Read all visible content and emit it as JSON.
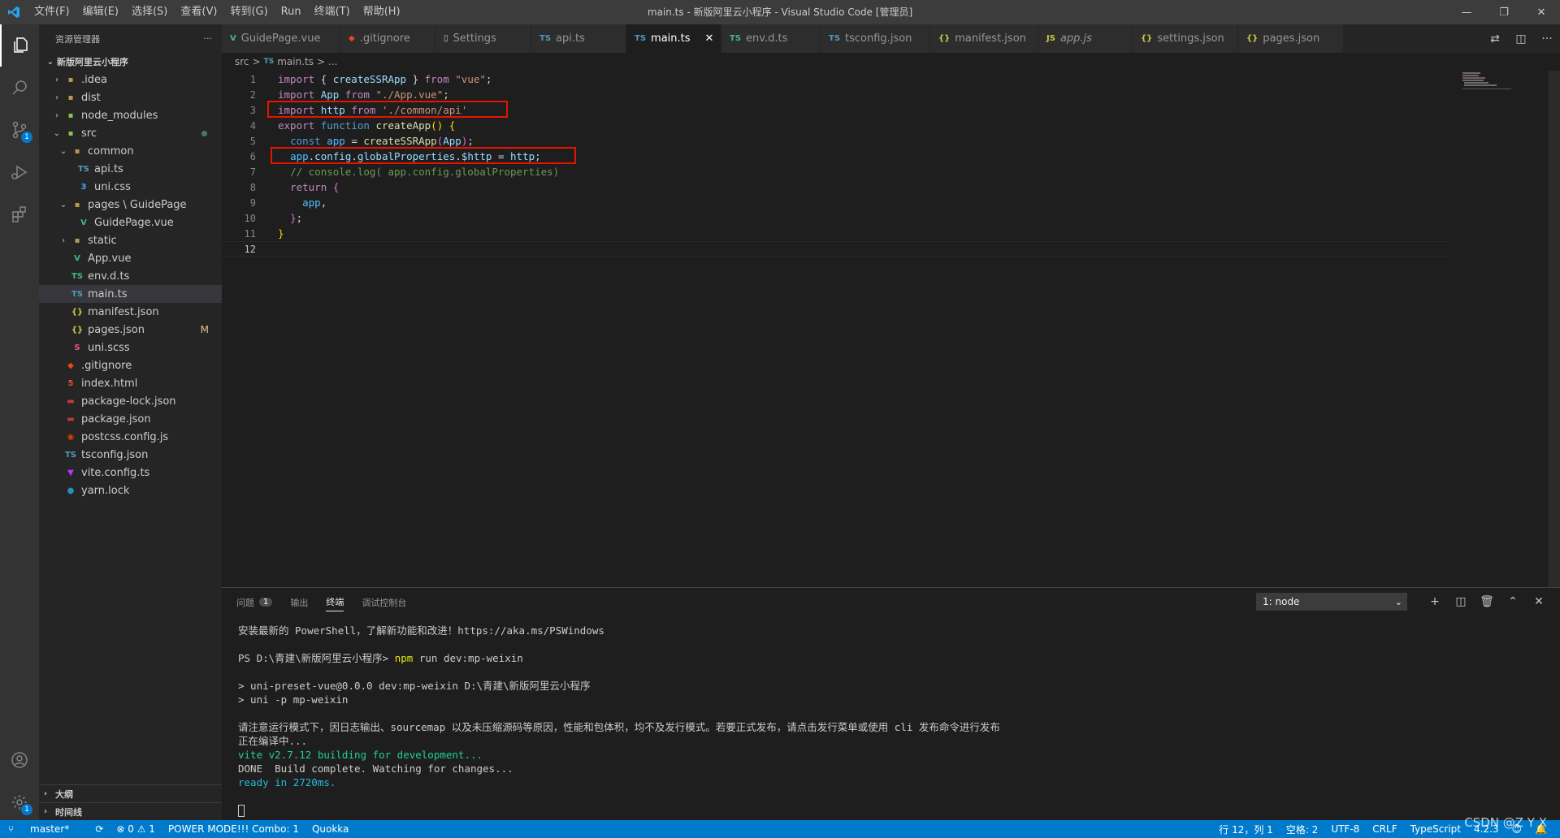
{
  "titlebar": {
    "menus": [
      "文件(F)",
      "编辑(E)",
      "选择(S)",
      "查看(V)",
      "转到(G)",
      "Run",
      "终端(T)",
      "帮助(H)"
    ],
    "title": "main.ts - 新版阿里云小程序 - Visual Studio Code [管理员]",
    "controls": [
      "—",
      "❐",
      "✕"
    ]
  },
  "activitybar": {
    "items": [
      "files-icon",
      "search-icon",
      "source-control-icon",
      "run-debug-icon",
      "extensions-icon"
    ],
    "scm_badge": "1",
    "settings_badge": "1"
  },
  "sidebar": {
    "header": "资源管理器",
    "more": "···",
    "project": "新版阿里云小程序",
    "tree": [
      {
        "label": ".idea",
        "indent": 1,
        "chev": "›",
        "icon": "▪",
        "iconColor": "#c09553"
      },
      {
        "label": "dist",
        "indent": 1,
        "chev": "›",
        "icon": "▪",
        "iconColor": "#c09553"
      },
      {
        "label": "node_modules",
        "indent": 1,
        "chev": "›",
        "icon": "▪",
        "iconColor": "#8bc34a"
      },
      {
        "label": "src",
        "indent": 1,
        "chev": "⌄",
        "icon": "▪",
        "iconColor": "#8bc34a",
        "dot": true
      },
      {
        "label": "common",
        "indent": 2,
        "chev": "⌄",
        "icon": "▪",
        "iconColor": "#c09553"
      },
      {
        "label": "api.ts",
        "indent": 3,
        "chev": "",
        "icon": "TS",
        "iconColor": "#519aba"
      },
      {
        "label": "uni.css",
        "indent": 3,
        "chev": "",
        "icon": "3",
        "iconColor": "#42a5f5"
      },
      {
        "label": "pages \\ GuidePage",
        "indent": 2,
        "chev": "⌄",
        "icon": "▪",
        "iconColor": "#c09553"
      },
      {
        "label": "GuidePage.vue",
        "indent": 3,
        "chev": "",
        "icon": "V",
        "iconColor": "#41b883"
      },
      {
        "label": "static",
        "indent": 2,
        "chev": "›",
        "icon": "▪",
        "iconColor": "#c09553"
      },
      {
        "label": "App.vue",
        "indent": 2,
        "chev": "",
        "icon": "V",
        "iconColor": "#41b883"
      },
      {
        "label": "env.d.ts",
        "indent": 2,
        "chev": "",
        "icon": "TS",
        "iconColor": "#41b883"
      },
      {
        "label": "main.ts",
        "indent": 2,
        "chev": "",
        "icon": "TS",
        "iconColor": "#519aba",
        "selected": true
      },
      {
        "label": "manifest.json",
        "indent": 2,
        "chev": "",
        "icon": "{}",
        "iconColor": "#cbcb41"
      },
      {
        "label": "pages.json",
        "indent": 2,
        "chev": "",
        "icon": "{}",
        "iconColor": "#cbcb41",
        "mark": "M"
      },
      {
        "label": "uni.scss",
        "indent": 2,
        "chev": "",
        "icon": "S",
        "iconColor": "#f55385"
      },
      {
        "label": ".gitignore",
        "indent": 1,
        "chev": "",
        "icon": "◆",
        "iconColor": "#e64a19"
      },
      {
        "label": "index.html",
        "indent": 1,
        "chev": "",
        "icon": "5",
        "iconColor": "#e44d26"
      },
      {
        "label": "package-lock.json",
        "indent": 1,
        "chev": "",
        "icon": "▬",
        "iconColor": "#cb3837"
      },
      {
        "label": "package.json",
        "indent": 1,
        "chev": "",
        "icon": "▬",
        "iconColor": "#cb3837"
      },
      {
        "label": "postcss.config.js",
        "indent": 1,
        "chev": "",
        "icon": "◉",
        "iconColor": "#dd3a0a"
      },
      {
        "label": "tsconfig.json",
        "indent": 1,
        "chev": "",
        "icon": "TS",
        "iconColor": "#519aba"
      },
      {
        "label": "vite.config.ts",
        "indent": 1,
        "chev": "",
        "icon": "▼",
        "iconColor": "#bd34fe"
      },
      {
        "label": "yarn.lock",
        "indent": 1,
        "chev": "",
        "icon": "●",
        "iconColor": "#2c8ebb"
      }
    ],
    "sections": [
      "大纲",
      "时间线"
    ]
  },
  "tabs": [
    {
      "label": "GuidePage.vue",
      "icon": "V",
      "iconColor": "#41b883"
    },
    {
      "label": ".gitignore",
      "icon": "◆",
      "iconColor": "#e64a19"
    },
    {
      "label": "Settings",
      "icon": "▯",
      "iconColor": "#c5c5c5"
    },
    {
      "label": "api.ts",
      "icon": "TS",
      "iconColor": "#519aba"
    },
    {
      "label": "main.ts",
      "icon": "TS",
      "iconColor": "#519aba",
      "active": true,
      "close": "✕"
    },
    {
      "label": "env.d.ts",
      "icon": "TS",
      "iconColor": "#41b883"
    },
    {
      "label": "tsconfig.json",
      "icon": "TS",
      "iconColor": "#519aba"
    },
    {
      "label": "manifest.json",
      "icon": "{}",
      "iconColor": "#cbcb41"
    },
    {
      "label": "app.js",
      "icon": "JS",
      "iconColor": "#cbcb41"
    },
    {
      "label": "settings.json",
      "icon": "{}",
      "iconColor": "#cbcb41"
    },
    {
      "label": "pages.json",
      "icon": "{}",
      "iconColor": "#cbcb41"
    }
  ],
  "breadcrumb": {
    "folder": "src",
    "sep": ">",
    "file_icon": "TS",
    "file": "main.ts",
    "rest": "..."
  },
  "editor": {
    "line_numbers": [
      "1",
      "2",
      "3",
      "4",
      "5",
      "6",
      "7",
      "8",
      "9",
      "10",
      "11",
      "12"
    ],
    "current_line": "12"
  },
  "panel": {
    "tabs": [
      {
        "label": "问题",
        "badge": "1"
      },
      {
        "label": "输出"
      },
      {
        "label": "终端",
        "active": true
      },
      {
        "label": "调试控制台"
      }
    ],
    "terminal_select": "1: node",
    "actions": [
      "+",
      "◫",
      "🗑",
      "⌃",
      "✕"
    ],
    "terminal": {
      "line1": "安装最新的 PowerShell，了解新功能和改进！https://aka.ms/PSWindows",
      "prompt": "PS D:\\青建\\新版阿里云小程序> ",
      "command": "npm",
      "command_rest": " run dev:mp-weixin",
      "line3": "> uni-preset-vue@0.0.0 dev:mp-weixin D:\\青建\\新版阿里云小程序",
      "line4": "> uni -p mp-weixin",
      "line5": "请注意运行模式下，因日志输出、sourcemap 以及未压缩源码等原因，性能和包体积，均不及发行模式。若要正式发布，请点击发行菜单或使用 cli 发布命令进行发布",
      "line6": "正在编译中...",
      "line7": "vite v2.7.12 building for development...",
      "line8": "DONE  Build complete. Watching for changes...",
      "line9": "ready in 2720ms."
    }
  },
  "statusbar": {
    "branch": "master*",
    "sync": "⟳",
    "problems": "⊗ 0 ⚠ 1",
    "power_mode": "POWER MODE!!! Combo: 1",
    "quokka": "Quokka",
    "position": "行 12，列 1",
    "spaces": "空格: 2",
    "encoding": "UTF-8",
    "eol": "CRLF",
    "language": "TypeScript",
    "version": "4.2.3"
  },
  "watermark": "CSDN @Z Y X",
  "colors": {
    "accent": "#007acc",
    "highlight_box": "#e51400"
  }
}
